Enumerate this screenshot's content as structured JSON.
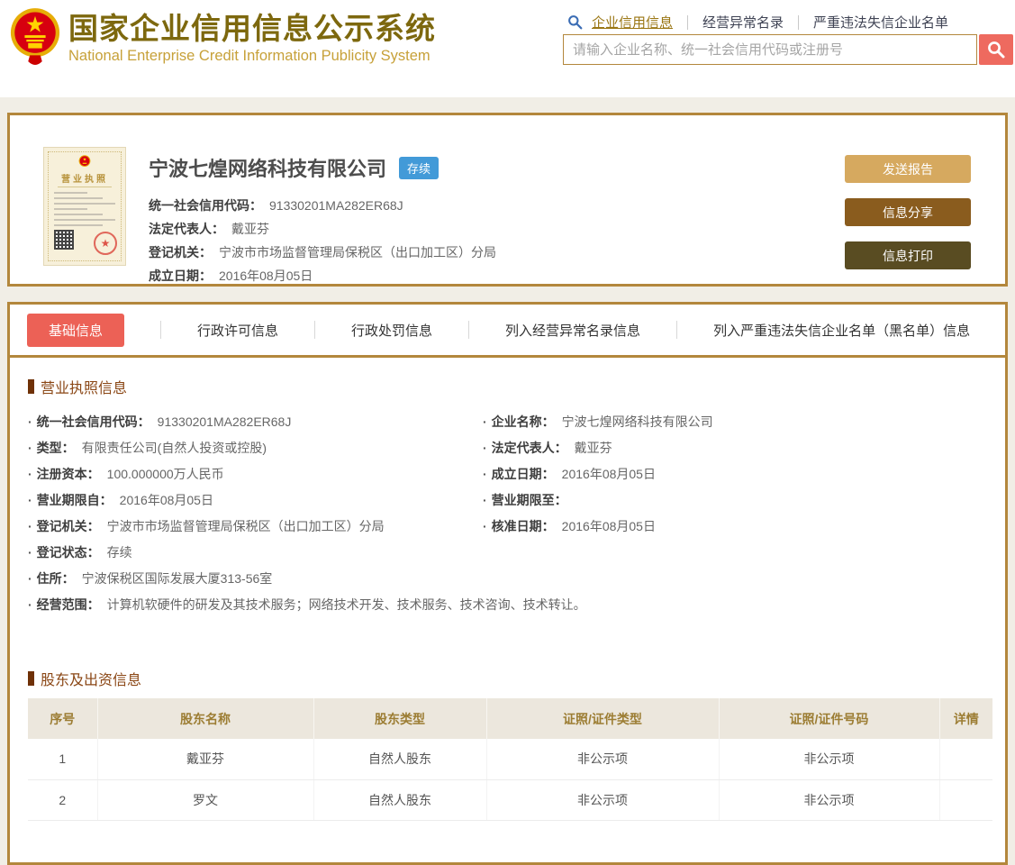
{
  "header": {
    "title_cn": "国家企业信用信息公示系统",
    "title_en": "National Enterprise Credit Information Publicity System",
    "nav": [
      {
        "label": "企业信用信息",
        "active": true
      },
      {
        "label": "经营异常名录",
        "active": false
      },
      {
        "label": "严重违法失信企业名单",
        "active": false
      }
    ],
    "search": {
      "placeholder": "请输入企业名称、统一社会信用代码或注册号"
    }
  },
  "company_card": {
    "license_thumb_title": "营业执照",
    "name": "宁波七煌网络科技有限公司",
    "status_badge": "存续",
    "fields": [
      {
        "label": "统一社会信用代码：",
        "value": "91330201MA282ER68J"
      },
      {
        "label": "法定代表人：",
        "value": "戴亚芬"
      },
      {
        "label": "登记机关：",
        "value": "宁波市市场监督管理局保税区（出口加工区）分局"
      },
      {
        "label": "成立日期：",
        "value": "2016年08月05日"
      }
    ],
    "buttons": [
      {
        "label": "发送报告",
        "color": "#d6a95f"
      },
      {
        "label": "信息分享",
        "color": "#8a5c1e"
      },
      {
        "label": "信息打印",
        "color": "#594c22"
      }
    ]
  },
  "tabs": [
    {
      "label": "基础信息",
      "active": true
    },
    {
      "label": "行政许可信息",
      "active": false
    },
    {
      "label": "行政处罚信息",
      "active": false
    },
    {
      "label": "列入经营异常名录信息",
      "active": false
    },
    {
      "label": "列入严重违法失信企业名单（黑名单）信息",
      "active": false
    }
  ],
  "license_info": {
    "section_title": "营业执照信息",
    "left": [
      {
        "label": "统一社会信用代码：",
        "value": "91330201MA282ER68J"
      },
      {
        "label": "类型：",
        "value": "有限责任公司(自然人投资或控股)"
      },
      {
        "label": "注册资本：",
        "value": "100.000000万人民币"
      },
      {
        "label": "营业期限自：",
        "value": "2016年08月05日"
      },
      {
        "label": "登记机关：",
        "value": "宁波市市场监督管理局保税区（出口加工区）分局"
      },
      {
        "label": "登记状态：",
        "value": "存续"
      },
      {
        "label": "住所：",
        "value": "宁波保税区国际发展大厦313-56室"
      },
      {
        "label": "经营范围：",
        "value": "计算机软硬件的研发及其技术服务；网络技术开发、技术服务、技术咨询、技术转让。"
      }
    ],
    "right": [
      {
        "label": "企业名称：",
        "value": "宁波七煌网络科技有限公司"
      },
      {
        "label": "法定代表人：",
        "value": "戴亚芬"
      },
      {
        "label": "成立日期：",
        "value": "2016年08月05日"
      },
      {
        "label": "营业期限至：",
        "value": ""
      },
      {
        "label": "核准日期：",
        "value": "2016年08月05日"
      }
    ]
  },
  "shareholders": {
    "section_title": "股东及出资信息",
    "columns": [
      "序号",
      "股东名称",
      "股东类型",
      "证照/证件类型",
      "证照/证件号码",
      "详情"
    ],
    "rows": [
      [
        "1",
        "戴亚芬",
        "自然人股东",
        "非公示项",
        "非公示项",
        ""
      ],
      [
        "2",
        "罗文",
        "自然人股东",
        "非公示项",
        "非公示项",
        ""
      ]
    ]
  },
  "colors": {
    "gold_border": "#b3873c",
    "brand_gold": "#7d680e",
    "accent_red": "#ec6156",
    "search_button_red": "#ee6a5f",
    "status_blue": "#429ad8"
  }
}
